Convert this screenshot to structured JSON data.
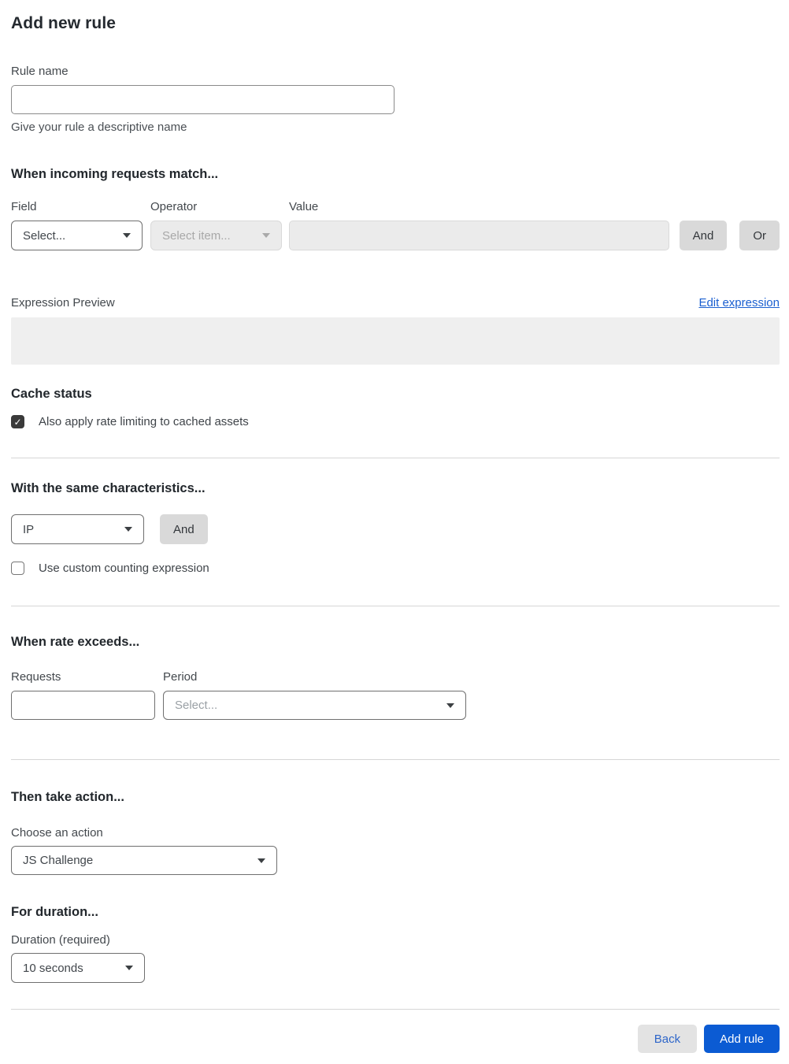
{
  "page": {
    "title": "Add new rule"
  },
  "rule_name": {
    "label": "Rule name",
    "value": "",
    "helper": "Give your rule a descriptive name"
  },
  "match": {
    "heading": "When incoming requests match...",
    "field": {
      "label": "Field",
      "value": "Select..."
    },
    "operator": {
      "label": "Operator",
      "value": "Select item..."
    },
    "value": {
      "label": "Value",
      "value": ""
    },
    "and_label": "And",
    "or_label": "Or"
  },
  "expression": {
    "label": "Expression Preview",
    "edit_link": "Edit expression",
    "preview": ""
  },
  "cache": {
    "heading": "Cache status",
    "checkbox_label": "Also apply rate limiting to cached assets",
    "checked": true
  },
  "characteristics": {
    "heading": "With the same characteristics...",
    "select_value": "IP",
    "and_label": "And",
    "checkbox_label": "Use custom counting expression",
    "checked": false
  },
  "rate": {
    "heading": "When rate exceeds...",
    "requests_label": "Requests",
    "requests_value": "",
    "period_label": "Period",
    "period_value": "Select..."
  },
  "action": {
    "heading": "Then take action...",
    "label": "Choose an action",
    "value": "JS Challenge"
  },
  "duration": {
    "heading": "For duration...",
    "label": "Duration (required)",
    "value": "10 seconds"
  },
  "footer": {
    "back_label": "Back",
    "submit_label": "Add rule"
  },
  "icons": {
    "check": "✓"
  },
  "colors": {
    "primary_button": "#0b5bd3",
    "link_blue": "#1a5fd0",
    "back_text_blue": "#2e66c9",
    "checkbox_checked": "#3a3a3a",
    "disabled_bg": "#ebebeb",
    "preview_bg": "#efefef",
    "divider": "#d6d6d6"
  }
}
